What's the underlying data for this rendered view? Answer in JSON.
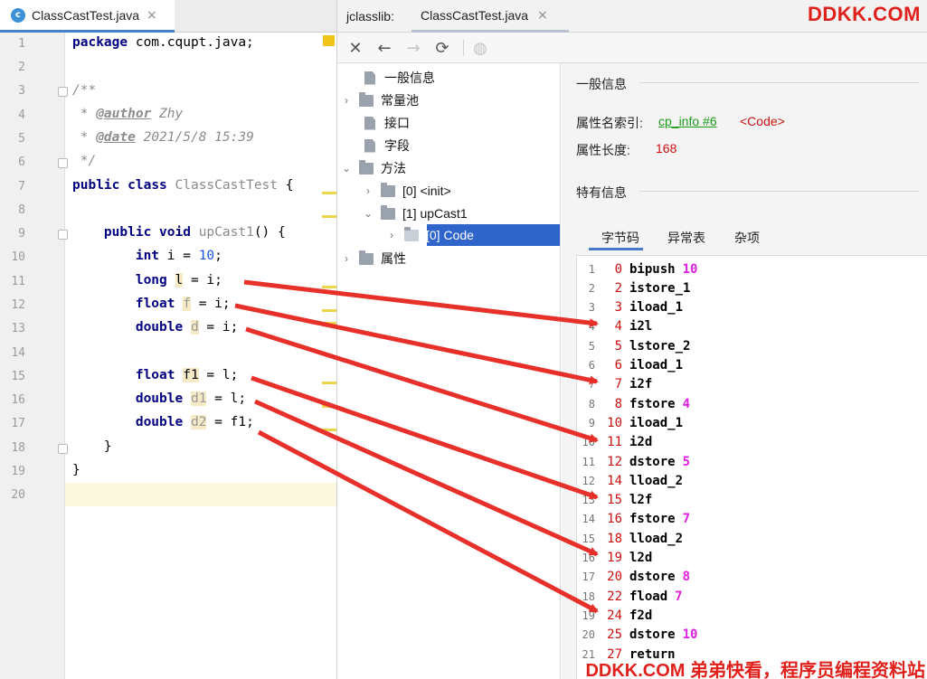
{
  "editor": {
    "tab": {
      "icon": "c",
      "label": "ClassCastTest.java",
      "close": "×"
    },
    "line_numbers": [
      "1",
      "2",
      "3",
      "4",
      "5",
      "6",
      "7",
      "8",
      "9",
      "10",
      "11",
      "12",
      "13",
      "14",
      "15",
      "16",
      "17",
      "18",
      "19",
      "20"
    ],
    "lines": {
      "l1_kw": "package",
      "l1_rest": " com.cqupt.java;",
      "l3": "/**",
      "l4_star": " * ",
      "l4_tag": "@author",
      "l4_val": " Zhy",
      "l5_star": " * ",
      "l5_tag": "@date",
      "l5_val": " 2021/5/8 15:39",
      "l6": " */",
      "l7_kw1": "public",
      "l7_kw2": "class",
      "l7_cls": "ClassCastTest",
      "l7_rest": " {",
      "l9_kw1": "public",
      "l9_kw2": "void",
      "l9_name": "upCast1",
      "l9_rest": "() {",
      "l10_kw": "int",
      "l10_var": " i = ",
      "l10_num": "10",
      "l10_end": ";",
      "l11_kw": "long",
      "l11_var": "l",
      "l11_rest": " = i;",
      "l12_kw": "float",
      "l12_var": "f",
      "l12_rest": " = i;",
      "l13_kw": "double",
      "l13_var": "d",
      "l13_rest": " = i;",
      "l15_kw": "float",
      "l15_var": "f1",
      "l15_rest": " = l;",
      "l16_kw": "double",
      "l16_var": "d1",
      "l16_rest": " = l;",
      "l17_kw": "double",
      "l17_var": "d2",
      "l17_rest": " = f1;",
      "l18": "}",
      "l19": "}"
    }
  },
  "jclasslib": {
    "tab_label": "jclasslib:",
    "file_tab": {
      "label": "ClassCastTest.java",
      "close": "×"
    },
    "brand": "DDKK.COM",
    "toolbar": {
      "close": "✕",
      "back": "←",
      "forward": "→",
      "refresh": "⟳",
      "browser": "◍"
    },
    "tree": {
      "general": "一般信息",
      "constant_pool": "常量池",
      "interfaces": "接口",
      "fields": "字段",
      "methods": "方法",
      "init": "[0] <init>",
      "upcast": "[1] upCast1",
      "code": "[0] Code",
      "attributes": "属性"
    },
    "details": {
      "general_title": "一般信息",
      "name_index_label": "属性名索引:",
      "name_index_link": "cp_info #6",
      "name_index_value": "<Code>",
      "length_label": "属性长度:",
      "length_value": "168",
      "specific_title": "特有信息",
      "sub_tabs": [
        "字节码",
        "异常表",
        "杂项"
      ]
    },
    "bytecode": [
      {
        "ln": "1",
        "off": "0",
        "op": "bipush",
        "arg": "10"
      },
      {
        "ln": "2",
        "off": "2",
        "op": "istore_1",
        "arg": ""
      },
      {
        "ln": "3",
        "off": "3",
        "op": "iload_1",
        "arg": ""
      },
      {
        "ln": "4",
        "off": "4",
        "op": "i2l",
        "arg": ""
      },
      {
        "ln": "5",
        "off": "5",
        "op": "lstore_2",
        "arg": ""
      },
      {
        "ln": "6",
        "off": "6",
        "op": "iload_1",
        "arg": ""
      },
      {
        "ln": "7",
        "off": "7",
        "op": "i2f",
        "arg": ""
      },
      {
        "ln": "8",
        "off": "8",
        "op": "fstore",
        "arg": "4"
      },
      {
        "ln": "9",
        "off": "10",
        "op": "iload_1",
        "arg": ""
      },
      {
        "ln": "10",
        "off": "11",
        "op": "i2d",
        "arg": ""
      },
      {
        "ln": "11",
        "off": "12",
        "op": "dstore",
        "arg": "5"
      },
      {
        "ln": "12",
        "off": "14",
        "op": "lload_2",
        "arg": ""
      },
      {
        "ln": "13",
        "off": "15",
        "op": "l2f",
        "arg": ""
      },
      {
        "ln": "14",
        "off": "16",
        "op": "fstore",
        "arg": "7"
      },
      {
        "ln": "15",
        "off": "18",
        "op": "lload_2",
        "arg": ""
      },
      {
        "ln": "16",
        "off": "19",
        "op": "l2d",
        "arg": ""
      },
      {
        "ln": "17",
        "off": "20",
        "op": "dstore",
        "arg": "8"
      },
      {
        "ln": "18",
        "off": "22",
        "op": "fload",
        "arg": "7"
      },
      {
        "ln": "19",
        "off": "24",
        "op": "f2d",
        "arg": ""
      },
      {
        "ln": "20",
        "off": "25",
        "op": "dstore",
        "arg": "10"
      },
      {
        "ln": "21",
        "off": "27",
        "op": "return",
        "arg": ""
      }
    ]
  },
  "footer_watermark": "DDKK.COM 弟弟快看，程序员编程资料站",
  "colors": {
    "keyword": "#000080",
    "offset": "#cc1111",
    "operand": "#e020e0",
    "arrow": "#e8302a",
    "link": "#1a9a1a",
    "selection": "#2f65ca"
  }
}
